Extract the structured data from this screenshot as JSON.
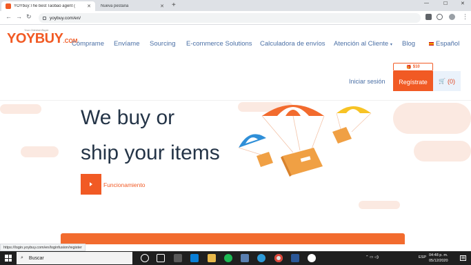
{
  "browser": {
    "tabs": [
      {
        "title": "YOYbuy:The best Taobao agent ("
      },
      {
        "title": "Nueva pestaña"
      }
    ],
    "url": "yoybuy.com/en/"
  },
  "site": {
    "logo_main": "YOYBUY",
    "logo_suffix": ".COM",
    "logo_tagline": "Your Chinese Buyer",
    "nav": [
      {
        "label": "Cómprame"
      },
      {
        "label": "Envíame"
      },
      {
        "label": "Sourcing"
      },
      {
        "label": "E-commerce Solutions"
      },
      {
        "label": "Calculadora de envíos"
      },
      {
        "label": "Atención al Cliente"
      },
      {
        "label": "Blog"
      }
    ],
    "language": "Español",
    "login_label": "Iniciar sesión",
    "register_label": "Regístrate",
    "promo_label": "$10",
    "cart_label": "(0)"
  },
  "hero": {
    "line1": "We buy or",
    "line2": "ship your items",
    "cta_label": "Funcionamiento"
  },
  "status_url": "https://login.yoybuy.com/en/loginfusion/register",
  "taskbar": {
    "search_label": "Buscar",
    "lang": "ESP",
    "time": "04:48 p. m.",
    "date": "05/12/2020"
  },
  "colors": {
    "brand": "#f15a24",
    "nav_text": "#4a6fa5",
    "headline": "#243447"
  }
}
